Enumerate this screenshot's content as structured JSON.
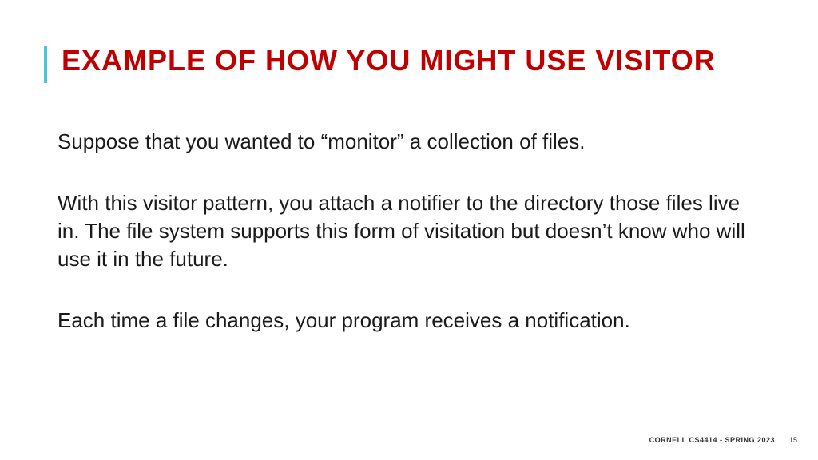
{
  "title": "EXAMPLE OF HOW YOU MIGHT USE VISITOR",
  "paragraphs": [
    "Suppose that you wanted to “monitor” a collection of files.",
    "With this visitor pattern, you attach a notifier to the directory those files live in.  The file system supports this form of visitation but doesn’t know who will use it in the future.",
    "Each time a file changes, your program receives a notification."
  ],
  "footer": {
    "course": "CORNELL CS4414 - SPRING 2023",
    "page": "15"
  }
}
